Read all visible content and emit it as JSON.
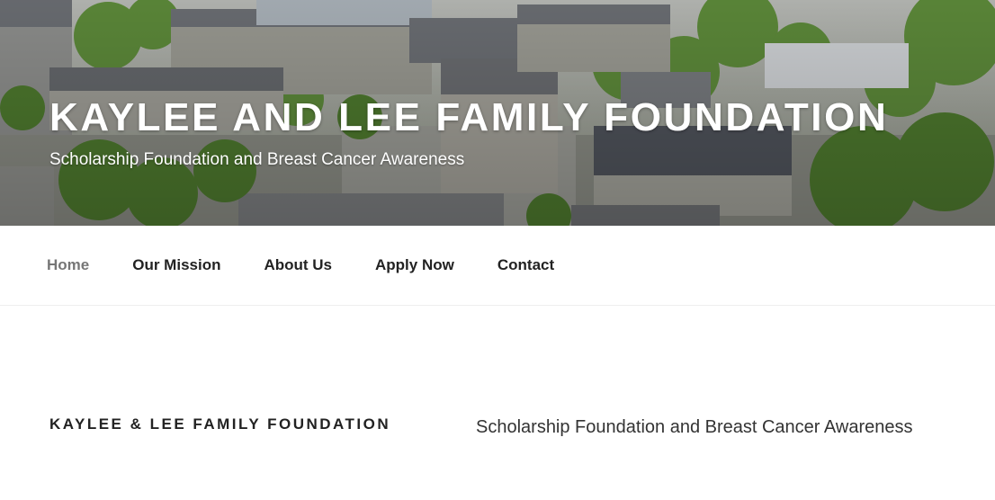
{
  "header": {
    "site_title": "KAYLEE AND LEE FAMILY FOUNDATION",
    "site_description": "Scholarship Foundation and Breast Cancer Awareness"
  },
  "nav": {
    "items": [
      {
        "label": "Home",
        "current": true
      },
      {
        "label": "Our Mission"
      },
      {
        "label": "About Us"
      },
      {
        "label": "Apply Now"
      },
      {
        "label": "Contact"
      }
    ]
  },
  "main": {
    "page_title": "KAYLEE & LEE FAMILY FOUNDATION",
    "intro": "Scholarship Foundation and Breast Cancer Awareness"
  },
  "colors": {
    "nav_current": "#767676",
    "text": "#222222",
    "foliage": "#5f8a3c",
    "roof": "#6b6e73"
  },
  "icons": []
}
